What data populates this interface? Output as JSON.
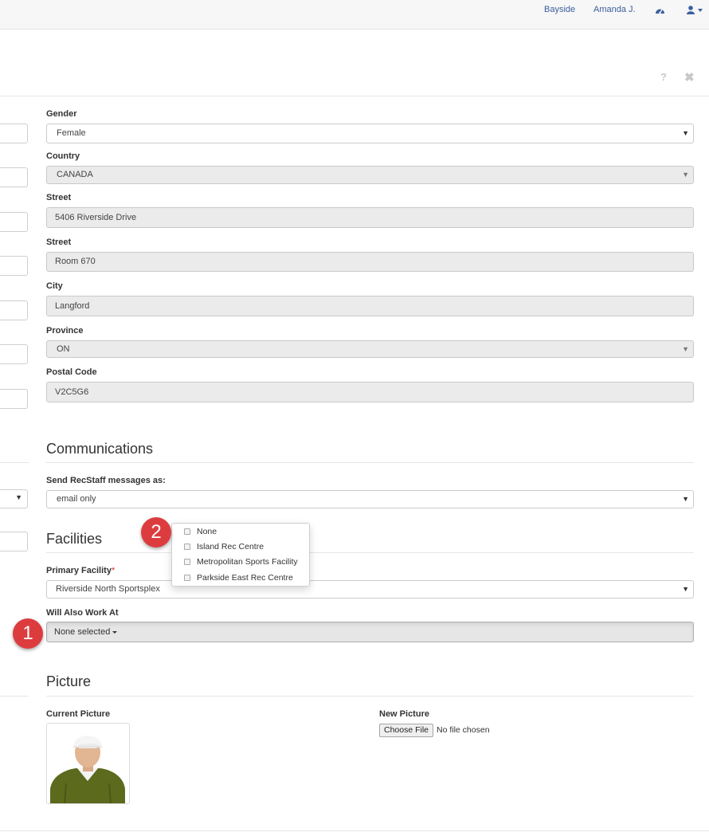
{
  "navbar": {
    "location": "Bayside",
    "user": "Amanda J."
  },
  "header": {
    "help": "?",
    "close": "✖"
  },
  "personal": {
    "gender": {
      "label": "Gender",
      "value": "Female"
    },
    "country": {
      "label": "Country",
      "value": "CANADA"
    },
    "street1": {
      "label": "Street",
      "value": "5406 Riverside Drive"
    },
    "street2": {
      "label": "Street",
      "value": "Room 670"
    },
    "city": {
      "label": "City",
      "value": "Langford"
    },
    "province": {
      "label": "Province",
      "value": "ON"
    },
    "postal": {
      "label": "Postal Code",
      "value": "V2C5G6"
    }
  },
  "communications": {
    "title": "Communications",
    "send_label": "Send RecStaff messages as:",
    "send_value": "email only"
  },
  "facilities": {
    "title": "Facilities",
    "primary_label": "Primary Facility",
    "required_mark": "*",
    "primary_value": "Riverside North Sportsplex",
    "also_label": "Will Also Work At",
    "also_value": "None selected",
    "options": [
      "None",
      "Island Rec Centre",
      "Metropolitan Sports Facility",
      "Parkside East Rec Centre"
    ]
  },
  "picture": {
    "title": "Picture",
    "current_label": "Current Picture",
    "new_label": "New Picture",
    "choose_file": "Choose File",
    "file_status": "No file chosen"
  },
  "callouts": {
    "one": "1",
    "two": "2"
  },
  "icons": {
    "dashboard": "dashboard-icon",
    "user": "user-icon",
    "caret": "caret-down-icon"
  },
  "colors": {
    "link": "#3a5f9c",
    "badge": "#dd3c3f",
    "required": "#c9302c",
    "readonly_bg": "#ebebeb"
  }
}
